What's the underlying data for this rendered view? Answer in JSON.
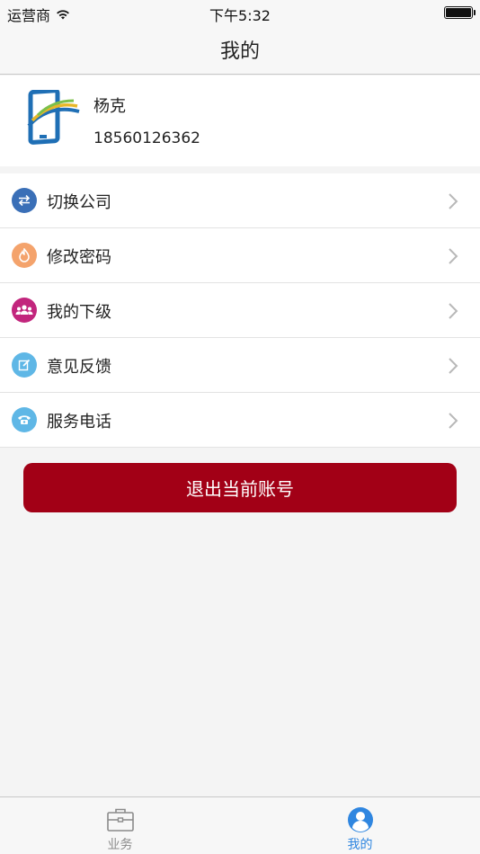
{
  "status_bar": {
    "carrier": "运营商",
    "time": "下午5:32"
  },
  "nav": {
    "title": "我的"
  },
  "profile": {
    "name": "杨克",
    "phone": "18560126362"
  },
  "menu": [
    {
      "label": "切换公司",
      "icon": "switch-arrows-icon",
      "color": "#3a6fb7"
    },
    {
      "label": "修改密码",
      "icon": "flame-icon",
      "color": "#f4a36c"
    },
    {
      "label": "我的下级",
      "icon": "group-people-icon",
      "color": "#c2267d"
    },
    {
      "label": "意见反馈",
      "icon": "edit-note-icon",
      "color": "#5fb7e6"
    },
    {
      "label": "服务电话",
      "icon": "phone-icon",
      "color": "#5fb7e6"
    }
  ],
  "logout": {
    "label": "退出当前账号",
    "color": "#a20016"
  },
  "tabs": [
    {
      "label": "业务",
      "icon": "briefcase-icon",
      "active": false
    },
    {
      "label": "我的",
      "icon": "user-circle-icon",
      "active": true
    }
  ],
  "colors": {
    "accent": "#2f86e0",
    "danger": "#a20016"
  }
}
